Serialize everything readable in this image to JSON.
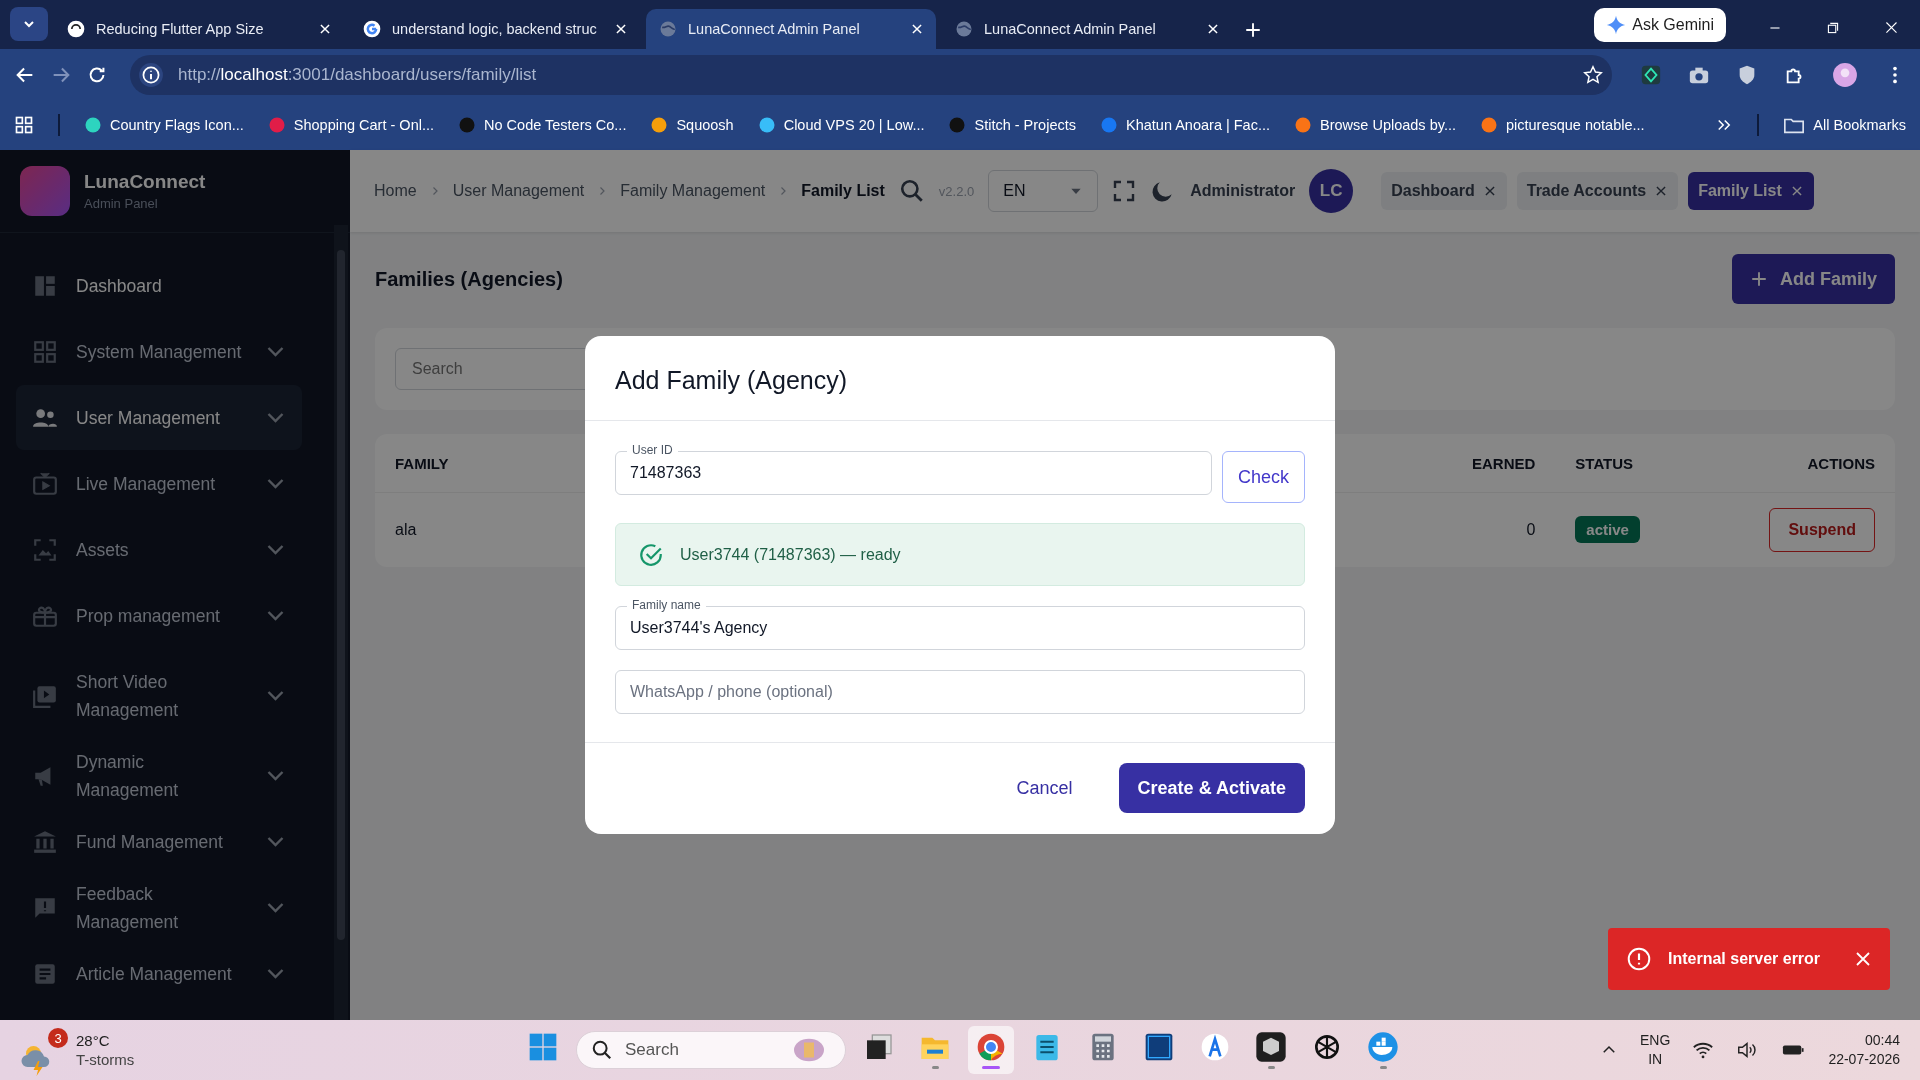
{
  "browser": {
    "tabs": [
      {
        "title": "Reducing Flutter App Size",
        "selected": false
      },
      {
        "title": "understand logic, backend struc",
        "selected": false
      },
      {
        "title": "LunaConnect Admin Panel",
        "selected": true
      },
      {
        "title": "LunaConnect Admin Panel",
        "selected": false
      }
    ],
    "ask_gemini": "Ask Gemini",
    "url": {
      "scheme": "http://",
      "host": "localhost",
      "rest": ":3001/dashboard/users/family/list"
    },
    "bookmarks": [
      "Country Flags Icon...",
      "Shopping Cart - Onl...",
      "No Code Testers Co...",
      "Squoosh",
      "Cloud VPS 20 | Low...",
      "Stitch - Projects",
      "Khatun Anoara | Fac...",
      "Browse Uploads by...",
      "picturesque notable..."
    ],
    "all_bookmarks": "All Bookmarks"
  },
  "app": {
    "brand": {
      "name": "LunaConnect",
      "subtitle": "Admin Panel"
    },
    "sidebar": {
      "items": [
        {
          "label": "Dashboard",
          "selected": false,
          "expandable": false
        },
        {
          "label": "System Management",
          "selected": false,
          "expandable": true
        },
        {
          "label": "User Management",
          "selected": true,
          "expandable": true
        },
        {
          "label": "Live Management",
          "selected": false,
          "expandable": true
        },
        {
          "label": "Assets",
          "selected": false,
          "expandable": true
        },
        {
          "label": "Prop management",
          "selected": false,
          "expandable": true
        },
        {
          "label": "Short Video Management",
          "selected": false,
          "expandable": true
        },
        {
          "label": "Dynamic Management",
          "selected": false,
          "expandable": true
        },
        {
          "label": "Fund Management",
          "selected": false,
          "expandable": true
        },
        {
          "label": "Feedback Management",
          "selected": false,
          "expandable": true
        },
        {
          "label": "Article Management",
          "selected": false,
          "expandable": true
        }
      ]
    },
    "header": {
      "breadcrumbs": [
        "Home",
        "User Management",
        "Family Management",
        "Family List"
      ],
      "version": "v2.2.0",
      "language": "EN",
      "user": "Administrator",
      "avatar": "LC",
      "page_tabs": [
        {
          "label": "Dashboard",
          "selected": false
        },
        {
          "label": "Trade Accounts",
          "selected": false
        },
        {
          "label": "Family List",
          "selected": true
        }
      ]
    },
    "page": {
      "title": "Families (Agencies)",
      "add_button": "Add Family",
      "search": {
        "placeholder": "Search"
      },
      "table": {
        "columns": [
          "FAMILY",
          "EARNED",
          "STATUS",
          "ACTIONS"
        ],
        "rows": [
          {
            "family": "ala",
            "earned": "0",
            "status": "active",
            "action": "Suspend"
          }
        ]
      }
    }
  },
  "modal": {
    "title": "Add Family (Agency)",
    "user_id": {
      "label": "User ID",
      "value": "71487363"
    },
    "check_button": "Check",
    "result": {
      "message": "User3744 (71487363) — ready",
      "kind": "success"
    },
    "family_name": {
      "label": "Family name",
      "value": "User3744's Agency"
    },
    "phone": {
      "placeholder": "WhatsApp / phone (optional)"
    },
    "cancel": "Cancel",
    "submit": "Create & Activate"
  },
  "toast": {
    "message": "Internal server error",
    "kind": "error"
  },
  "taskbar": {
    "weather": {
      "badge": "3",
      "temperature": "28°C",
      "condition": "T-storms"
    },
    "search": {
      "placeholder": "Search"
    },
    "apps": [
      {
        "kind": "windows",
        "running": false,
        "selected": false
      },
      {
        "kind": "taskview",
        "running": false,
        "selected": false
      },
      {
        "kind": "files",
        "running": true,
        "selected": false
      },
      {
        "kind": "chrome",
        "running": true,
        "selected": true
      },
      {
        "kind": "notepad",
        "running": false,
        "selected": false
      },
      {
        "kind": "calculator",
        "running": false,
        "selected": false
      },
      {
        "kind": "photoshop",
        "running": false,
        "selected": false
      },
      {
        "kind": "studio",
        "running": false,
        "selected": false
      },
      {
        "kind": "cube",
        "running": true,
        "selected": false
      },
      {
        "kind": "openai",
        "running": false,
        "selected": false
      },
      {
        "kind": "docker",
        "running": true,
        "selected": false
      }
    ],
    "language": {
      "line1": "ENG",
      "line2": "IN"
    },
    "time": "00:44",
    "date": "22-07-2026"
  }
}
